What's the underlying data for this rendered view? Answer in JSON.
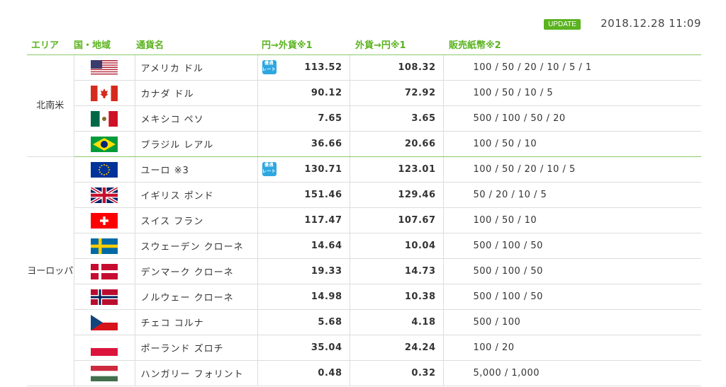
{
  "update": {
    "badge": "UPDATE",
    "timestamp": "2018.12.28 11:09"
  },
  "headers": {
    "area": "エリア",
    "country": "国・地域",
    "currency": "通貨名",
    "yen_to_foreign": "円→外貨※1",
    "foreign_to_yen": "外貨→円※1",
    "notes": "販売紙幣※2"
  },
  "rate_icon": {
    "line1": "優遇",
    "line2": "レート"
  },
  "areas": [
    {
      "name": "北南米",
      "rows": [
        {
          "flag": "us-flag-icon",
          "currency": "アメリカ ドル",
          "preferred": true,
          "buy": "113.52",
          "sell": "108.32",
          "notes": "100 / 50 / 20 / 10 / 5 / 1"
        },
        {
          "flag": "canada-flag-icon",
          "currency": "カナダ ドル",
          "preferred": false,
          "buy": "90.12",
          "sell": "72.92",
          "notes": "100 / 50 / 10 / 5"
        },
        {
          "flag": "mexico-flag-icon",
          "currency": "メキシコ ペソ",
          "preferred": false,
          "buy": "7.65",
          "sell": "3.65",
          "notes": "500 / 100 / 50 / 20"
        },
        {
          "flag": "brazil-flag-icon",
          "currency": "ブラジル レアル",
          "preferred": false,
          "buy": "36.66",
          "sell": "20.66",
          "notes": "100 / 50 / 10"
        }
      ]
    },
    {
      "name": "ヨーロッパ",
      "rows": [
        {
          "flag": "eu-flag-icon",
          "currency": "ユーロ ※3",
          "preferred": true,
          "buy": "130.71",
          "sell": "123.01",
          "notes": "100 / 50 / 20 / 10 / 5"
        },
        {
          "flag": "uk-flag-icon",
          "currency": "イギリス ポンド",
          "preferred": false,
          "buy": "151.46",
          "sell": "129.46",
          "notes": "50 / 20 / 10 / 5"
        },
        {
          "flag": "swiss-flag-icon",
          "currency": "スイス フラン",
          "preferred": false,
          "buy": "117.47",
          "sell": "107.67",
          "notes": "100 / 50 / 10"
        },
        {
          "flag": "sweden-flag-icon",
          "currency": "スウェーデン クローネ",
          "preferred": false,
          "buy": "14.64",
          "sell": "10.04",
          "notes": "500 / 100 / 50"
        },
        {
          "flag": "denmark-flag-icon",
          "currency": "デンマーク クローネ",
          "preferred": false,
          "buy": "19.33",
          "sell": "14.73",
          "notes": "500 / 100 / 50"
        },
        {
          "flag": "norway-flag-icon",
          "currency": "ノルウェー クローネ",
          "preferred": false,
          "buy": "14.98",
          "sell": "10.38",
          "notes": "500 / 100 / 50"
        },
        {
          "flag": "czech-flag-icon",
          "currency": "チェコ コルナ",
          "preferred": false,
          "buy": "5.68",
          "sell": "4.18",
          "notes": "500 / 100"
        },
        {
          "flag": "poland-flag-icon",
          "currency": "ポーランド ズロチ",
          "preferred": false,
          "buy": "35.04",
          "sell": "24.24",
          "notes": "100 / 20"
        },
        {
          "flag": "hungary-flag-icon",
          "currency": "ハンガリー フォリント",
          "preferred": false,
          "buy": "0.48",
          "sell": "0.32",
          "notes": "5,000 / 1,000"
        }
      ]
    }
  ]
}
